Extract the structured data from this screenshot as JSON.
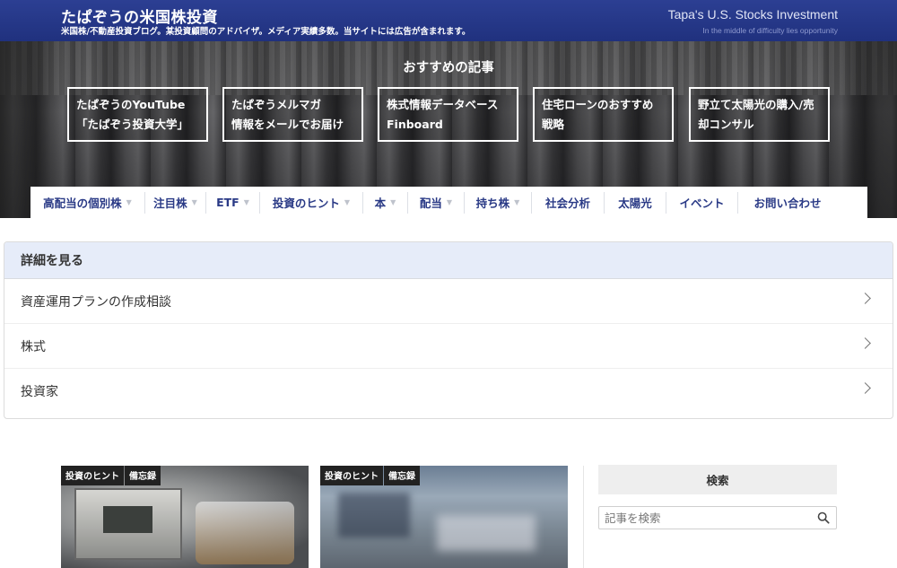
{
  "header": {
    "title": "たぱぞうの米国株投資",
    "subtitle": "米国株/不動産投資ブログ。某投資顧問のアドバイザ。メディア実績多数。当サイトには広告が含まれます。",
    "brand_en": "Tapa's U.S. Stocks Investment",
    "brand_tagline": "In the middle of difficulty lies opportunity"
  },
  "hero": {
    "section_title": "おすすめの記事",
    "boxes": [
      {
        "line1": "たぱぞうのYouTube",
        "line2": "「たぱぞう投資大学」"
      },
      {
        "line1": "たぱぞうメルマガ",
        "line2": "情報をメールでお届け"
      },
      {
        "line1": "株式情報データベース",
        "line2": "Finboard"
      },
      {
        "line1": "住宅ローンのおすすめ",
        "line2": "戦略"
      },
      {
        "line1": "野立て太陽光の購入/売",
        "line2": "却コンサル"
      }
    ]
  },
  "nav": {
    "items": [
      {
        "label": "高配当の個別株",
        "caret": true
      },
      {
        "label": "注目株",
        "caret": true
      },
      {
        "label": "ETF",
        "caret": true
      },
      {
        "label": "投資のヒント",
        "caret": true
      },
      {
        "label": "本",
        "caret": true
      },
      {
        "label": "配当",
        "caret": true
      },
      {
        "label": "持ち株",
        "caret": true
      },
      {
        "label": "社会分析",
        "caret": false
      },
      {
        "label": "太陽光",
        "caret": false
      },
      {
        "label": "イベント",
        "caret": false
      },
      {
        "label": "お問い合わせ",
        "caret": false
      }
    ],
    "caret_glyph": "▼"
  },
  "details": {
    "heading": "詳細を見る",
    "rows": [
      "資産運用プランの作成相談",
      "株式",
      "投資家"
    ]
  },
  "cards": [
    {
      "tags": [
        "投資のヒント",
        "備忘録"
      ]
    },
    {
      "tags": [
        "投資のヒント",
        "備忘録"
      ]
    }
  ],
  "sidebar": {
    "search_heading": "検索",
    "search_placeholder": "記事を検索"
  },
  "colors": {
    "header_bg": "#20317e",
    "nav_text": "#2a3a86",
    "panel_head_bg": "#e6ecf9"
  }
}
